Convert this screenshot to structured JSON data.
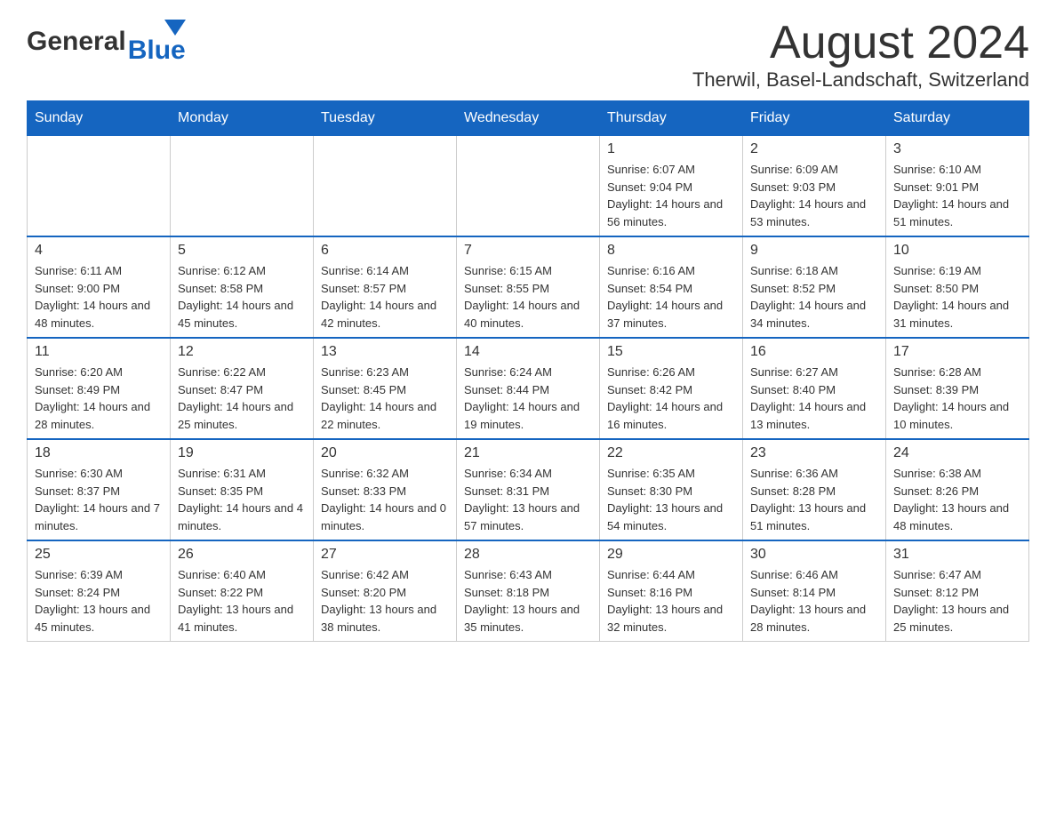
{
  "header": {
    "logo_general": "General",
    "logo_blue": "Blue",
    "month_title": "August 2024",
    "location": "Therwil, Basel-Landschaft, Switzerland"
  },
  "calendar": {
    "days_of_week": [
      "Sunday",
      "Monday",
      "Tuesday",
      "Wednesday",
      "Thursday",
      "Friday",
      "Saturday"
    ],
    "rows": [
      [
        {
          "day": "",
          "info": ""
        },
        {
          "day": "",
          "info": ""
        },
        {
          "day": "",
          "info": ""
        },
        {
          "day": "",
          "info": ""
        },
        {
          "day": "1",
          "info": "Sunrise: 6:07 AM\nSunset: 9:04 PM\nDaylight: 14 hours and 56 minutes."
        },
        {
          "day": "2",
          "info": "Sunrise: 6:09 AM\nSunset: 9:03 PM\nDaylight: 14 hours and 53 minutes."
        },
        {
          "day": "3",
          "info": "Sunrise: 6:10 AM\nSunset: 9:01 PM\nDaylight: 14 hours and 51 minutes."
        }
      ],
      [
        {
          "day": "4",
          "info": "Sunrise: 6:11 AM\nSunset: 9:00 PM\nDaylight: 14 hours and 48 minutes."
        },
        {
          "day": "5",
          "info": "Sunrise: 6:12 AM\nSunset: 8:58 PM\nDaylight: 14 hours and 45 minutes."
        },
        {
          "day": "6",
          "info": "Sunrise: 6:14 AM\nSunset: 8:57 PM\nDaylight: 14 hours and 42 minutes."
        },
        {
          "day": "7",
          "info": "Sunrise: 6:15 AM\nSunset: 8:55 PM\nDaylight: 14 hours and 40 minutes."
        },
        {
          "day": "8",
          "info": "Sunrise: 6:16 AM\nSunset: 8:54 PM\nDaylight: 14 hours and 37 minutes."
        },
        {
          "day": "9",
          "info": "Sunrise: 6:18 AM\nSunset: 8:52 PM\nDaylight: 14 hours and 34 minutes."
        },
        {
          "day": "10",
          "info": "Sunrise: 6:19 AM\nSunset: 8:50 PM\nDaylight: 14 hours and 31 minutes."
        }
      ],
      [
        {
          "day": "11",
          "info": "Sunrise: 6:20 AM\nSunset: 8:49 PM\nDaylight: 14 hours and 28 minutes."
        },
        {
          "day": "12",
          "info": "Sunrise: 6:22 AM\nSunset: 8:47 PM\nDaylight: 14 hours and 25 minutes."
        },
        {
          "day": "13",
          "info": "Sunrise: 6:23 AM\nSunset: 8:45 PM\nDaylight: 14 hours and 22 minutes."
        },
        {
          "day": "14",
          "info": "Sunrise: 6:24 AM\nSunset: 8:44 PM\nDaylight: 14 hours and 19 minutes."
        },
        {
          "day": "15",
          "info": "Sunrise: 6:26 AM\nSunset: 8:42 PM\nDaylight: 14 hours and 16 minutes."
        },
        {
          "day": "16",
          "info": "Sunrise: 6:27 AM\nSunset: 8:40 PM\nDaylight: 14 hours and 13 minutes."
        },
        {
          "day": "17",
          "info": "Sunrise: 6:28 AM\nSunset: 8:39 PM\nDaylight: 14 hours and 10 minutes."
        }
      ],
      [
        {
          "day": "18",
          "info": "Sunrise: 6:30 AM\nSunset: 8:37 PM\nDaylight: 14 hours and 7 minutes."
        },
        {
          "day": "19",
          "info": "Sunrise: 6:31 AM\nSunset: 8:35 PM\nDaylight: 14 hours and 4 minutes."
        },
        {
          "day": "20",
          "info": "Sunrise: 6:32 AM\nSunset: 8:33 PM\nDaylight: 14 hours and 0 minutes."
        },
        {
          "day": "21",
          "info": "Sunrise: 6:34 AM\nSunset: 8:31 PM\nDaylight: 13 hours and 57 minutes."
        },
        {
          "day": "22",
          "info": "Sunrise: 6:35 AM\nSunset: 8:30 PM\nDaylight: 13 hours and 54 minutes."
        },
        {
          "day": "23",
          "info": "Sunrise: 6:36 AM\nSunset: 8:28 PM\nDaylight: 13 hours and 51 minutes."
        },
        {
          "day": "24",
          "info": "Sunrise: 6:38 AM\nSunset: 8:26 PM\nDaylight: 13 hours and 48 minutes."
        }
      ],
      [
        {
          "day": "25",
          "info": "Sunrise: 6:39 AM\nSunset: 8:24 PM\nDaylight: 13 hours and 45 minutes."
        },
        {
          "day": "26",
          "info": "Sunrise: 6:40 AM\nSunset: 8:22 PM\nDaylight: 13 hours and 41 minutes."
        },
        {
          "day": "27",
          "info": "Sunrise: 6:42 AM\nSunset: 8:20 PM\nDaylight: 13 hours and 38 minutes."
        },
        {
          "day": "28",
          "info": "Sunrise: 6:43 AM\nSunset: 8:18 PM\nDaylight: 13 hours and 35 minutes."
        },
        {
          "day": "29",
          "info": "Sunrise: 6:44 AM\nSunset: 8:16 PM\nDaylight: 13 hours and 32 minutes."
        },
        {
          "day": "30",
          "info": "Sunrise: 6:46 AM\nSunset: 8:14 PM\nDaylight: 13 hours and 28 minutes."
        },
        {
          "day": "31",
          "info": "Sunrise: 6:47 AM\nSunset: 8:12 PM\nDaylight: 13 hours and 25 minutes."
        }
      ]
    ]
  }
}
